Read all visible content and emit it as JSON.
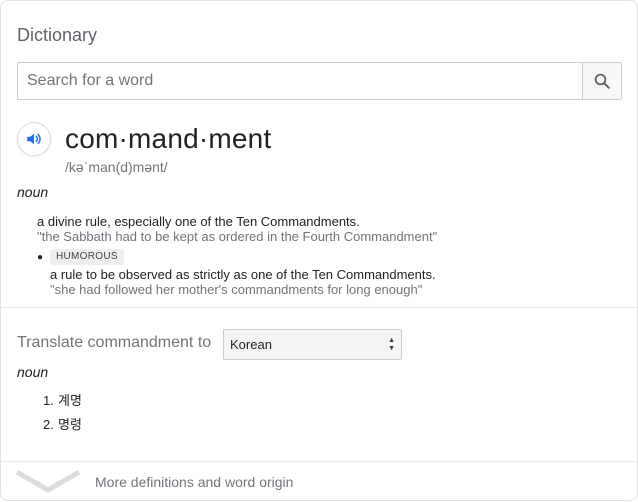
{
  "dictionary": {
    "title": "Dictionary",
    "search": {
      "placeholder": "Search for a word",
      "value": "",
      "button_icon": "search-icon"
    },
    "entry": {
      "audio_icon": "speaker-icon",
      "headword": "com·mand·ment",
      "phonetic": "/kəˈman(d)mənt/",
      "part_of_speech": "noun",
      "definitions": [
        {
          "text": "a divine rule, especially one of the Ten Commandments.",
          "example": "\"the Sabbath had to be kept as ordered in the Fourth Commandment\""
        },
        {
          "label": "HUMOROUS",
          "text": "a rule to be observed as strictly as one of the Ten Commandments.",
          "example": "\"she had followed her mother's commandments for long enough\""
        }
      ]
    },
    "translate": {
      "label": "Translate commandment to",
      "language": "Korean",
      "part_of_speech": "noun",
      "items": [
        {
          "num": "1.",
          "text": "계명"
        },
        {
          "num": "2.",
          "text": "명령"
        }
      ]
    },
    "more": {
      "label": "More definitions and word origin",
      "icon": "chevron-down-icon"
    }
  },
  "colors": {
    "accent": "#1a73e8",
    "muted": "#70757a",
    "divider": "#e8eaed"
  }
}
